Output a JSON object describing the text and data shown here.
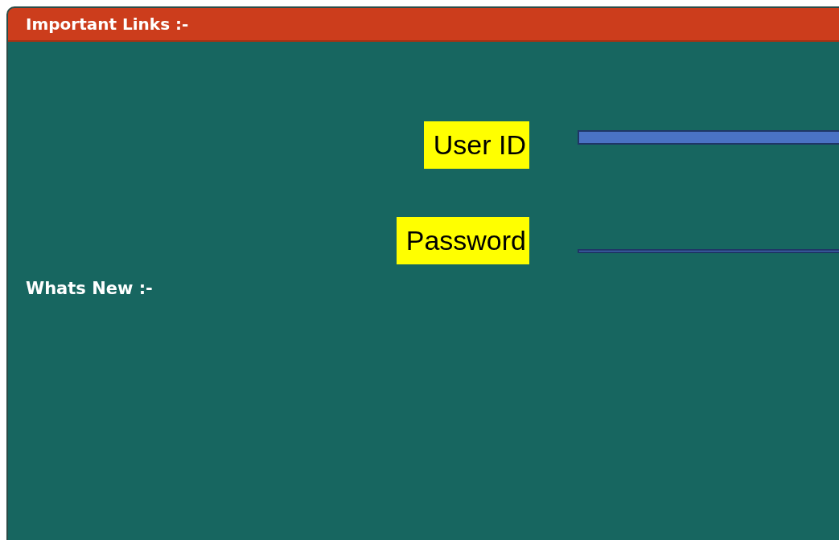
{
  "header": {
    "title": "Important Links :-"
  },
  "login": {
    "fields": [
      {
        "label": "User ID"
      },
      {
        "label": "Password"
      }
    ]
  },
  "whats_new": {
    "title": "Whats New :-"
  }
}
